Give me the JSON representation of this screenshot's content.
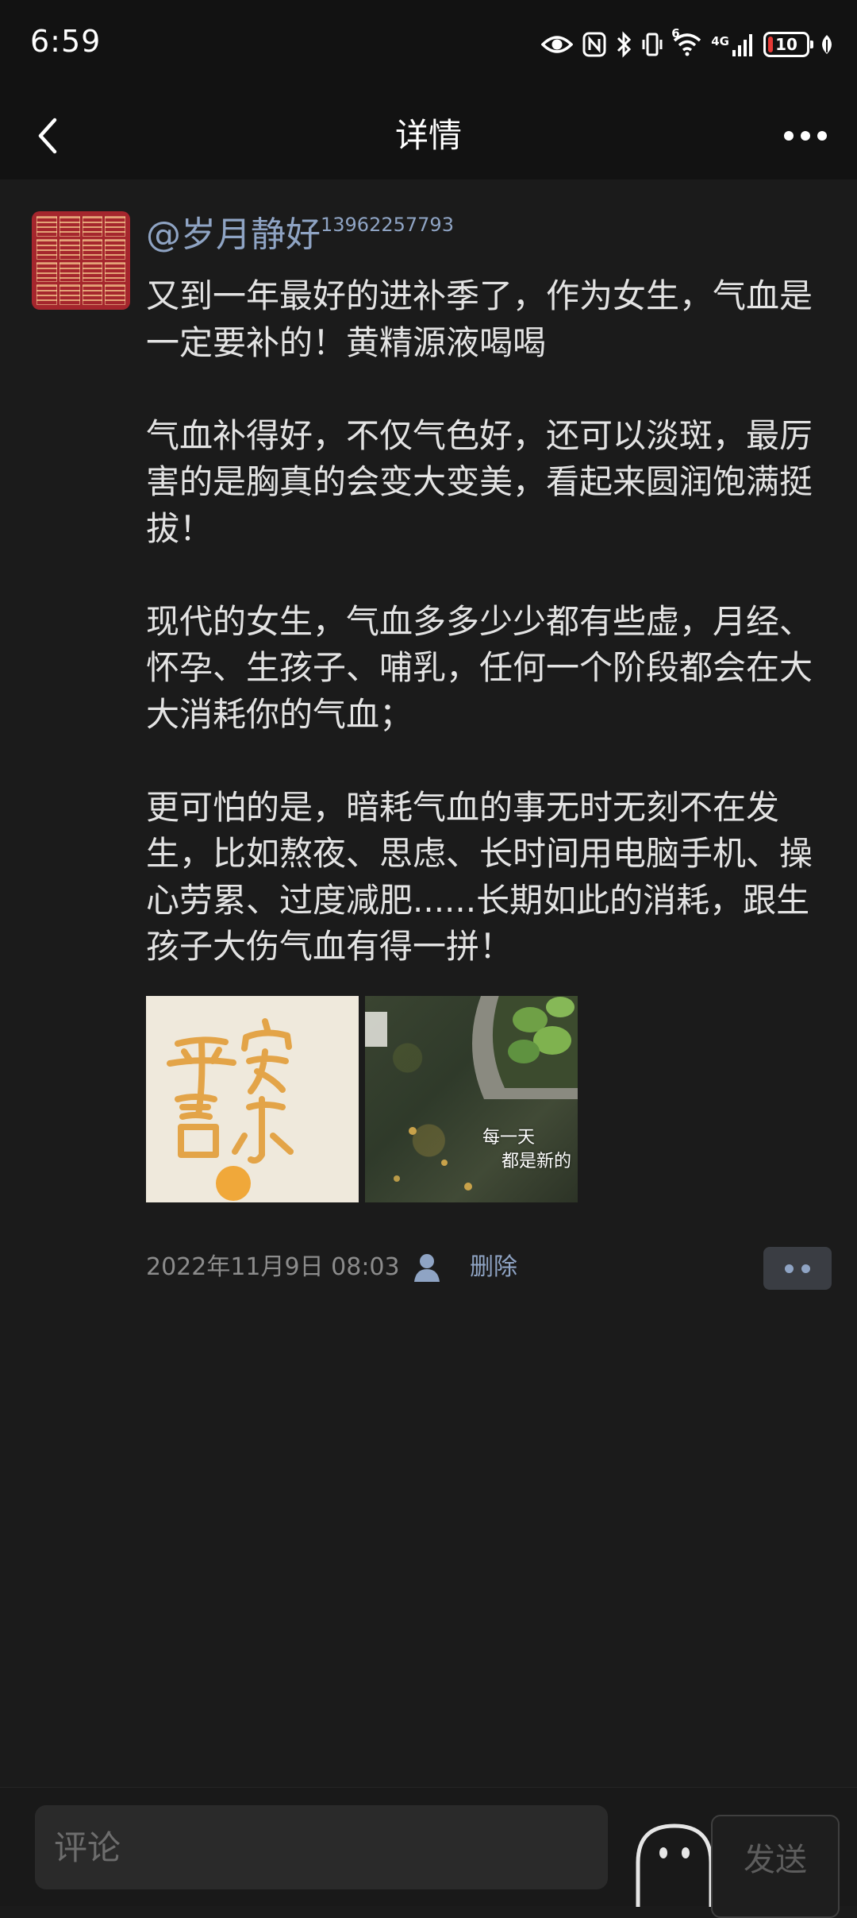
{
  "status_bar": {
    "time": "6:59",
    "icons": [
      "eye-icon",
      "nfc-icon",
      "bluetooth-icon",
      "vibrate-icon",
      "wifi-icon",
      "signal-icon",
      "battery-icon",
      "leaf-icon"
    ],
    "wifi_label": "6",
    "network_label": "4G",
    "battery_level": "10"
  },
  "header": {
    "title": "详情",
    "back_icon": "chevron-left-icon",
    "more_icon": "more-dots-icon"
  },
  "post": {
    "author_name": "@岁月静好",
    "author_phone": "13962257793",
    "paragraphs": [
      "又到一年最好的进补季了，作为女生，气血是一定要补的！黄精源液喝喝",
      "气血补得好，不仅气色好，还可以淡斑，最厉害的是胸真的会变大变美，看起来圆润饱满挺拔！",
      "现代的女生，气血多多少少都有些虚，月经、怀孕、生孩子、哺乳，任何一个阶段都会在大大消耗你的气血；",
      "更可怕的是，暗耗气血的事无时无刻不在发生，比如熬夜、思虑、长时间用电脑手机、操心劳累、过度减肥......长期如此的消耗，跟生孩子大伤气血有得一拼！"
    ],
    "photos": [
      {
        "caption": ""
      },
      {
        "caption_line1": "每一天",
        "caption_line2": "都是新的"
      }
    ],
    "timestamp": "2022年11月9日 08:03",
    "delete_label": "删除",
    "privacy_icon": "person-icon",
    "action_icon": "two-dots-icon"
  },
  "comment_bar": {
    "placeholder": "评论",
    "emoji_icon": "emoji-face-icon",
    "send_label": "发送"
  },
  "colors": {
    "background": "#1b1b1b",
    "header_bg": "#121212",
    "link_blue": "#8fa4c4",
    "muted_text": "#8c8c8c",
    "body_text": "#e3e3e3"
  }
}
